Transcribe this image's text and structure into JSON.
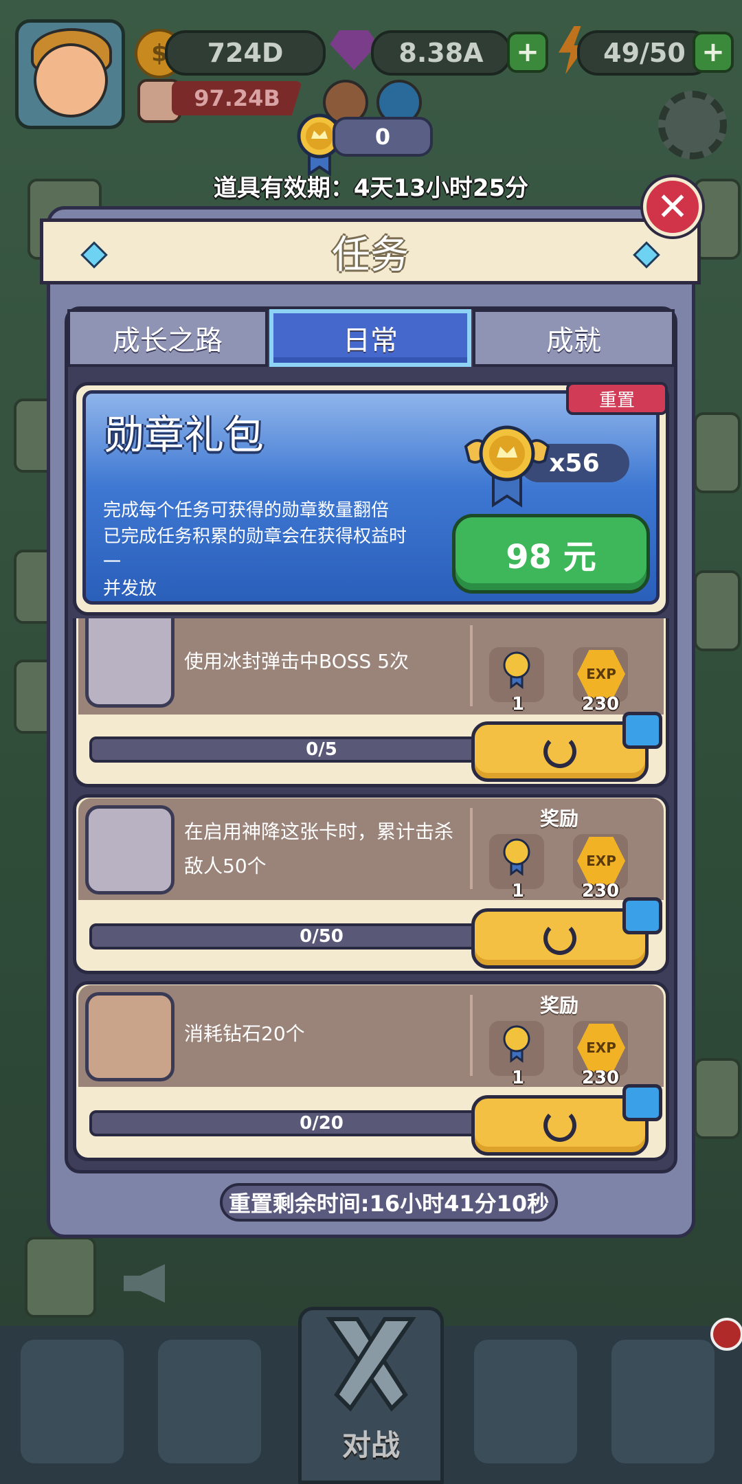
{
  "hud": {
    "coins": "724D",
    "gems": "8.38A",
    "energy": "49/50",
    "power": "97.24B",
    "medal_count": "0",
    "validity": "道具有效期：4天13小时25分"
  },
  "modal": {
    "title": "任务",
    "close_icon": "close-icon",
    "tabs": [
      "成长之路",
      "日常",
      "成就"
    ],
    "active_tab": "日常",
    "pack": {
      "title": "勋章礼包",
      "reset_label": "重置",
      "multiplier": "x56",
      "desc_line1": "完成每个任务可获得的勋章数量翻倍",
      "desc_line2": "已完成任务积累的勋章会在获得权益时一",
      "desc_line3": "并发放",
      "price": "98 元"
    },
    "reward_header": "奖励",
    "tasks": [
      {
        "text": "使用冰封弹击中BOSS 5次",
        "progress": "0/5",
        "medal": "1",
        "exp": "230",
        "icon": "crossed-swords-icon"
      },
      {
        "text": "在启用神降这张卡时，累计击杀敌人50个",
        "progress": "0/50",
        "medal": "1",
        "exp": "230",
        "icon": "crossed-swords-icon"
      },
      {
        "text": "消耗钻石20个",
        "progress": "0/20",
        "medal": "1",
        "exp": "230",
        "icon": "treasure-bag-icon"
      }
    ],
    "exp_label": "EXP",
    "reset_timer": "重置剩余时间:16小时41分10秒"
  },
  "nav": {
    "center_label": "对战"
  },
  "colors": {
    "modal_bg": "#7e84a7",
    "tab_active": "#4468cc",
    "price_green": "#3eb75a",
    "refresh_yellow": "#f4c043",
    "close_red": "#d13449"
  }
}
